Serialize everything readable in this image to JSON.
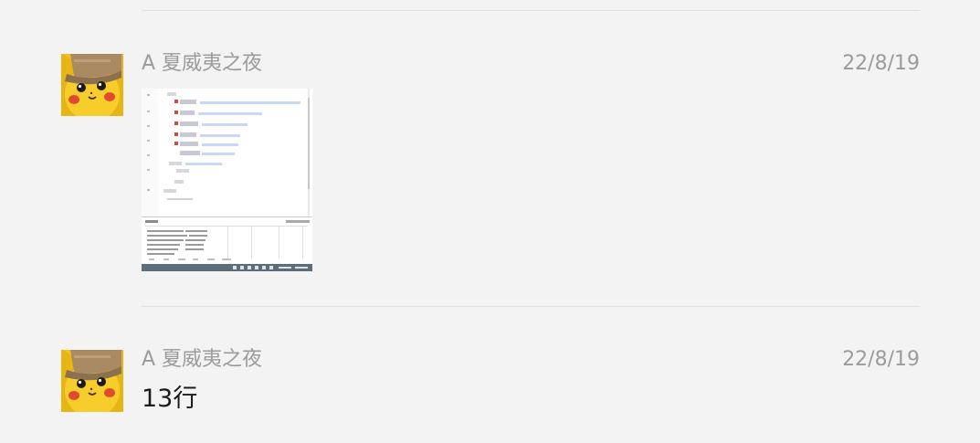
{
  "messages": [
    {
      "sender": "A 夏威夷之夜",
      "time": "22/8/19",
      "type": "image",
      "avatar_icon": "pikachu-detective-avatar",
      "image_icon": "screenshot-thumbnail"
    },
    {
      "sender": "A 夏威夷之夜",
      "time": "22/8/19",
      "type": "text",
      "text": "13行",
      "avatar_icon": "pikachu-detective-avatar"
    }
  ],
  "colors": {
    "background": "#f3f3f3",
    "divider": "#e1e1e1",
    "meta_text": "#9b9b9b",
    "body_text": "#1b1b1b",
    "pikachu_yellow": "#f4c81f",
    "hat_brown": "#a98a63"
  }
}
